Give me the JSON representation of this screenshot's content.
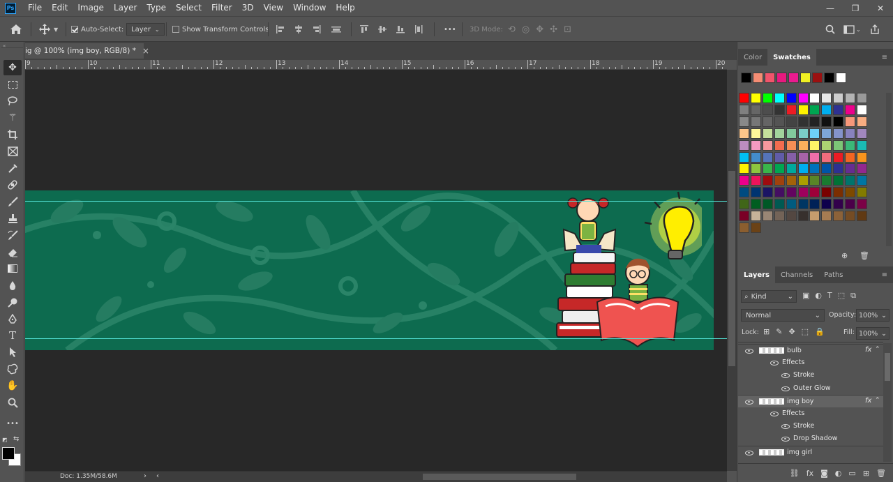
{
  "app": {
    "logo_text": "Ps"
  },
  "menu": [
    "File",
    "Edit",
    "Image",
    "Layer",
    "Type",
    "Select",
    "Filter",
    "3D",
    "View",
    "Window",
    "Help"
  ],
  "window_controls": {
    "minimize": "—",
    "restore": "❐",
    "close": "✕"
  },
  "options_bar": {
    "auto_select_label": "Auto-Select:",
    "auto_select_checked": true,
    "auto_select_target": "Layer",
    "show_transform_label": "Show Transform Controls",
    "show_transform_checked": false,
    "mode_3d_label": "3D Mode:",
    "more_label": "•••"
  },
  "document": {
    "tab_title": "ig @ 100% (img boy, RGB/8) *",
    "close_glyph": "×",
    "status": "Doc: 1.35M/58.6M"
  },
  "ruler": {
    "labels": [
      "9",
      "10",
      "11",
      "12",
      "13",
      "14",
      "15",
      "16",
      "17",
      "18",
      "19",
      "20"
    ]
  },
  "tools": [
    "move-tool",
    "marquee-tool",
    "lasso-tool",
    "magic-wand-tool",
    "crop-tool",
    "frame-tool",
    "eyedropper-tool",
    "healing-brush-tool",
    "brush-tool",
    "clone-stamp-tool",
    "history-brush-tool",
    "eraser-tool",
    "gradient-tool",
    "blur-tool",
    "dodge-tool",
    "pen-tool",
    "type-tool",
    "path-selection-tool",
    "shape-tool",
    "hand-tool",
    "zoom-tool",
    "edit-toolbar"
  ],
  "tool_text": {
    "type_tool": "T",
    "more": "•••"
  },
  "swatches_panel": {
    "tabs": [
      "Color",
      "Swatches"
    ],
    "active_tab": "Swatches",
    "recent": [
      "#000000",
      "#f58d74",
      "#f2546b",
      "#e8197f",
      "#ea1b8f",
      "#f0f023",
      "#9b1010",
      "#000000",
      "#ffffff"
    ],
    "grid": [
      [
        "#ff0000",
        "#ffff00",
        "#00ff00",
        "#00ffff",
        "#0000ff",
        "#ff00ff",
        "#ffffff",
        "#e6e6e6",
        "#cccccc",
        "#b3b3b3",
        "#999999"
      ],
      [
        "#808080",
        "#666666",
        "#4d4d4d",
        "#333333",
        "#ed1c24",
        "#fff200",
        "#00a651",
        "#00aeef",
        "#2e3192",
        "#ec008c",
        "#ffffff"
      ],
      [
        "#898989",
        "#777777",
        "#656565",
        "#545454",
        "#434343",
        "#323232",
        "#222222",
        "#111111",
        "#000000",
        "#f7977a",
        "#f9ad81"
      ],
      [
        "#fdc68a",
        "#fff79a",
        "#c4df9b",
        "#a2d39c",
        "#82ca9d",
        "#7bcdc8",
        "#6ecff6",
        "#7ea7d8",
        "#8493ca",
        "#8882be",
        "#a187be"
      ],
      [
        "#bc8dbf",
        "#f49ac2",
        "#f6989d",
        "#f26c4f",
        "#f68e55",
        "#fbaf5c",
        "#fff467",
        "#acd372",
        "#7cc576",
        "#3bb878",
        "#1abbb4"
      ],
      [
        "#00bff3",
        "#438ccb",
        "#5574b9",
        "#605ca8",
        "#855fa8",
        "#a763a8",
        "#f06ea9",
        "#f26d7d",
        "#ed1c24",
        "#f26522",
        "#f7941d"
      ],
      [
        "#fff200",
        "#8dc63f",
        "#39b54a",
        "#00a651",
        "#00a99d",
        "#00aeef",
        "#0072bc",
        "#0054a6",
        "#2e3192",
        "#662d91",
        "#92278f"
      ],
      [
        "#ec008c",
        "#ed145b",
        "#9e0b0f",
        "#a0410d",
        "#a36209",
        "#aba000",
        "#598527",
        "#197b30",
        "#007236",
        "#00746b",
        "#0076a3"
      ],
      [
        "#004b80",
        "#003471",
        "#1b1464",
        "#440e62",
        "#630460",
        "#9e005d",
        "#9e0039",
        "#790000",
        "#7b2e00",
        "#7d4900",
        "#827b00"
      ],
      [
        "#406618",
        "#005e20",
        "#005826",
        "#005952",
        "#005b7f",
        "#003663",
        "#002157",
        "#0d004c",
        "#32004b",
        "#4b0049",
        "#7b0046"
      ],
      [
        "#7a0026",
        "#c7b299",
        "#998675",
        "#736357",
        "#534741",
        "#37302d",
        "#c69c6d",
        "#a67c52",
        "#8c6239",
        "#754c24",
        "#603913"
      ],
      [
        "#8b5e2f",
        "#6b4216"
      ]
    ]
  },
  "layers_panel": {
    "tabs": [
      "Layers",
      "Channels",
      "Paths"
    ],
    "active_tab": "Layers",
    "filter_label": "Kind",
    "blend_mode": "Normal",
    "opacity_label": "Opacity:",
    "opacity_value": "100%",
    "lock_label": "Lock:",
    "fill_label": "Fill:",
    "fill_value": "100%",
    "rows": [
      {
        "name": "bulb",
        "fx": "fx",
        "depth": 0
      },
      {
        "name": "Effects",
        "fx": "",
        "depth": 1
      },
      {
        "name": "Stroke",
        "fx": "",
        "depth": 2
      },
      {
        "name": "Outer Glow",
        "fx": "",
        "depth": 2
      },
      {
        "name": "img boy",
        "fx": "fx",
        "depth": 0,
        "selected": true
      },
      {
        "name": "Effects",
        "fx": "",
        "depth": 1
      },
      {
        "name": "Stroke",
        "fx": "",
        "depth": 2
      },
      {
        "name": "Drop Shadow",
        "fx": "",
        "depth": 2
      },
      {
        "name": "img girl",
        "fx": "",
        "depth": 0
      }
    ]
  },
  "colors": {
    "banner": "#0d6b4f",
    "guide": "#53e2d6",
    "canvas_bg": "#282828",
    "ui_bg": "#535353"
  }
}
